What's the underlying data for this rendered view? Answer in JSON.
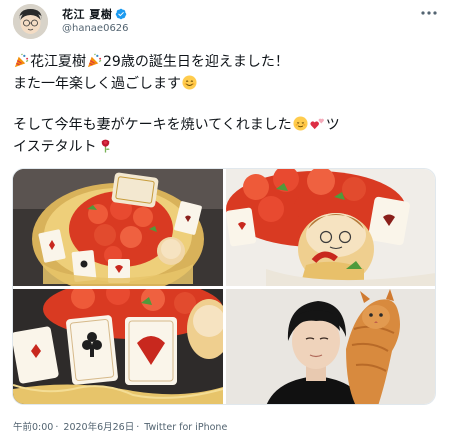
{
  "tweet": {
    "display_name": "花江 夏樹",
    "handle": "@hanae0626",
    "line1_a": "花江夏樹",
    "line1_b": "29歳の誕生日を迎えました！",
    "line2": "また一年楽しく過ごします",
    "line3": "そして今年も妻がケーキを焼いてくれました",
    "line3_b": "ツ",
    "line4": "イステタルト",
    "time": "午前0:00",
    "date": "2020年6月26日",
    "separator": "·",
    "source": "Twitter for iPhone"
  },
  "icons": {
    "avatar": "avatar-illustration",
    "verified": "verified-badge-icon",
    "more": "more-options-icon",
    "emoji_party": "party-popper-emoji",
    "emoji_smile": "smiling-face-emoji",
    "emoji_relieved": "relieved-face-emoji",
    "emoji_hearts": "two-hearts-emoji",
    "emoji_rose": "rose-emoji"
  },
  "media": {
    "photos": [
      "cake-photo-top-left",
      "cake-photo-top-right",
      "cake-photo-bottom-left",
      "person-with-cat-photo"
    ]
  },
  "colors": {
    "verified": "#1d9bf0",
    "text_secondary": "#536471",
    "tart_red": "#e0452b"
  }
}
